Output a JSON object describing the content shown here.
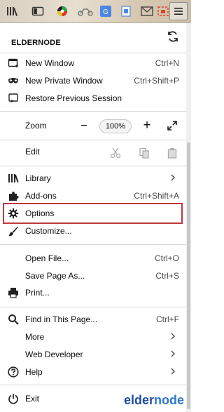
{
  "header": {
    "title": "ELDERNODE"
  },
  "menu": {
    "new_window": {
      "label": "New Window",
      "shortcut": "Ctrl+N"
    },
    "new_private": {
      "label": "New Private Window",
      "shortcut": "Ctrl+Shift+P"
    },
    "restore": {
      "label": "Restore Previous Session"
    },
    "zoom": {
      "label": "Zoom",
      "value": "100%",
      "minus": "−",
      "plus": "+"
    },
    "edit": {
      "label": "Edit"
    },
    "library": {
      "label": "Library"
    },
    "addons": {
      "label": "Add-ons",
      "shortcut": "Ctrl+Shift+A"
    },
    "options": {
      "label": "Options"
    },
    "customize": {
      "label": "Customize..."
    },
    "open_file": {
      "label": "Open File...",
      "shortcut": "Ctrl+O"
    },
    "save_page": {
      "label": "Save Page As...",
      "shortcut": "Ctrl+S"
    },
    "print": {
      "label": "Print..."
    },
    "find": {
      "label": "Find in This Page...",
      "shortcut": "Ctrl+F"
    },
    "more": {
      "label": "More"
    },
    "web_dev": {
      "label": "Web Developer"
    },
    "help": {
      "label": "Help"
    },
    "exit": {
      "label": "Exit"
    }
  },
  "watermark": {
    "text_a": "elder",
    "text_b": "node"
  },
  "colors": {
    "highlight": "#c0373b",
    "separator": "#d7d7db",
    "watermark": "#1f4fa3"
  },
  "icons": {
    "toolbar": [
      "library-icon",
      "sidebar-icon",
      "color-wheel-icon",
      "motorcycle-icon",
      "translate-icon",
      "tab-icon",
      "mail-icon",
      "screenshot-icon",
      "hamburger-menu-icon"
    ]
  }
}
